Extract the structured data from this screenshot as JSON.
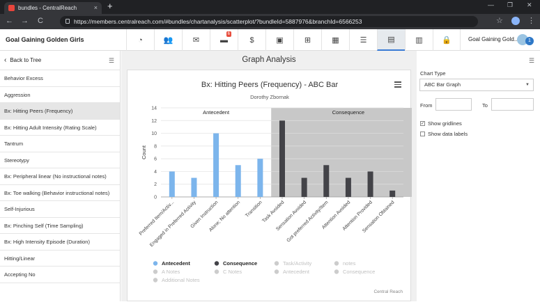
{
  "browser": {
    "tab_title": "bundles - CentralReach",
    "new_tab": "+",
    "url": "https://members.centralreach.com/#bundles/chartanalysis/scatterplot/?bundleId=5887976&branchId=6566253",
    "back": "←",
    "forward": "→",
    "reload": "C",
    "close_tab": "×",
    "win_min": "—",
    "win_max": "❐",
    "win_close": "✕",
    "star": "☆",
    "kebab": "⋮"
  },
  "header": {
    "brand": "Goal Gaining Golden Girls",
    "user": "Goal Gaining Gold...",
    "avatar_badge": "1",
    "nav": [
      {
        "icon": "dashboard-icon",
        "glyph": "◔"
      },
      {
        "icon": "users-icon",
        "glyph": "👥"
      },
      {
        "icon": "mail-icon",
        "glyph": "✉"
      },
      {
        "icon": "briefcase-icon",
        "glyph": "▬",
        "badge": "6"
      },
      {
        "icon": "dollar-icon",
        "glyph": "$"
      },
      {
        "icon": "money-icon",
        "glyph": "▣"
      },
      {
        "icon": "add-calendar-icon",
        "glyph": "⊞"
      },
      {
        "icon": "calendar-icon",
        "glyph": "▦"
      },
      {
        "icon": "list-icon",
        "glyph": "☰"
      },
      {
        "icon": "book-icon",
        "glyph": "▤",
        "active": true
      },
      {
        "icon": "bar-chart-icon",
        "glyph": "▥"
      },
      {
        "icon": "lock-icon",
        "glyph": "🔒"
      }
    ]
  },
  "sidebar": {
    "back_label": "Back to Tree",
    "back_glyph": "‹",
    "menu_glyph": "☰",
    "items": [
      {
        "label": "Behavior Excess"
      },
      {
        "label": "Aggression"
      },
      {
        "label": "Bx: Hitting Peers (Frequency)",
        "active": true
      },
      {
        "label": "Bx: Hitting Adult Intensity (Rating Scale)"
      },
      {
        "label": "Tantrum"
      },
      {
        "label": "Stereotypy"
      },
      {
        "label": "Bx: Peripheral linear (No instructional notes)"
      },
      {
        "label": "Bx: Toe walking (Behavior instructional notes)"
      },
      {
        "label": "Self-Injurious"
      },
      {
        "label": "Bx: Pinching Self (Time Sampling)"
      },
      {
        "label": "Bx: High Intensity Episode (Duration)"
      },
      {
        "label": "Hitting/Linear"
      },
      {
        "label": "Accepting No"
      }
    ]
  },
  "main": {
    "title": "Graph Analysis"
  },
  "right_panel": {
    "menu_glyph": "☰",
    "chart_type_label": "Chart Type",
    "chart_type_value": "ABC Bar Graph",
    "caret": "▼",
    "from_label": "From",
    "to_label": "To",
    "show_gridlines_label": "Show gridlines",
    "show_gridlines_checked": true,
    "check_glyph": "✓",
    "show_data_labels_label": "Show data labels",
    "show_data_labels_checked": false
  },
  "chart_data": {
    "type": "bar",
    "title": "Bx: Hitting Peers (Frequency) - ABC Bar",
    "subtitle": "Dorothy Zbornak",
    "ylabel": "Count",
    "ylim": [
      0,
      14
    ],
    "yticks": [
      0,
      2,
      4,
      6,
      8,
      10,
      12,
      14
    ],
    "grid": true,
    "credit": "Central Reach",
    "bands": [
      {
        "label": "Antecedent",
        "from_index": 0,
        "to_index": 5,
        "shaded": false
      },
      {
        "label": "Consequence",
        "from_index": 5,
        "to_index": 12,
        "shaded": true
      }
    ],
    "categories": [
      "Preferred Item/Activ...",
      "Engaged in Preferred Activity",
      "Given Instruction",
      "Alone; No attention",
      "Transition",
      "Task Avoided",
      "Sensation Avoided",
      "Got preferred Activity/Item",
      "Attention Avoided",
      "Attention Provided",
      "Sensation Obtained"
    ],
    "series": [
      {
        "name": "Antecedent",
        "color": "#7cb5ec",
        "values": [
          4,
          3,
          10,
          5,
          6,
          0,
          0,
          0,
          0,
          0,
          0
        ]
      },
      {
        "name": "Consequence",
        "color": "#434348",
        "values": [
          0,
          0,
          0,
          0,
          0,
          12,
          3,
          5,
          3,
          4,
          1
        ]
      }
    ],
    "legend": [
      {
        "name": "Antecedent",
        "color": "#7cb5ec",
        "active": true
      },
      {
        "name": "Consequence",
        "color": "#434348",
        "active": true
      },
      {
        "name": "Task/Activity",
        "color": "#cccccc",
        "active": false
      },
      {
        "name": "notes",
        "color": "#cccccc",
        "active": false
      },
      {
        "name": "A Notes",
        "color": "#cccccc",
        "active": false
      },
      {
        "name": "C Notes",
        "color": "#cccccc",
        "active": false
      },
      {
        "name": "Antecedent",
        "color": "#cccccc",
        "active": false
      },
      {
        "name": "Consequence",
        "color": "#cccccc",
        "active": false
      },
      {
        "name": "Additional Notes",
        "color": "#cccccc",
        "active": false
      }
    ],
    "legend_placement": "bottom"
  }
}
